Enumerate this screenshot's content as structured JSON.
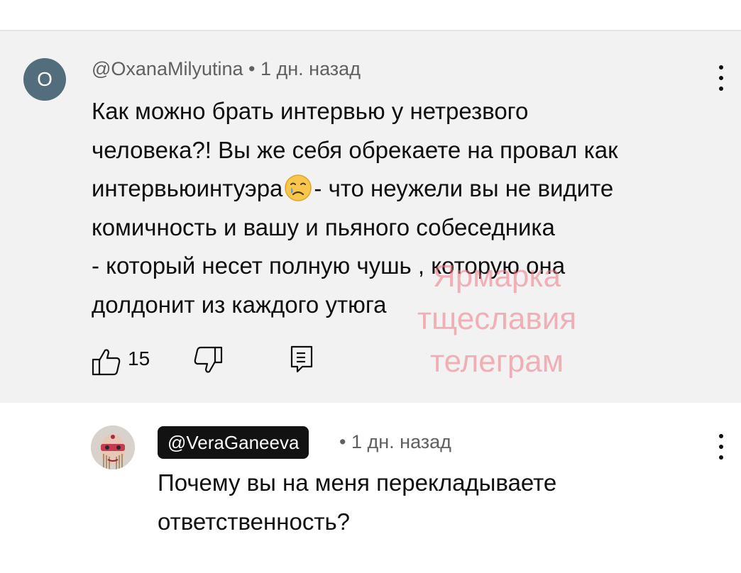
{
  "comments": [
    {
      "avatar_letter": "O",
      "avatar_color": "#526e7c",
      "author": "@OxanaMilyutina",
      "separator": "•",
      "time": "1 дн. назад",
      "text_lines": [
        "Как можно брать интервью у нетрезвого",
        "человека?! Вы же себя обрекаете на провал как",
        "интервьюинтуэра",
        "- что неужели вы не видите",
        "комичность и вашу и пьяного собеседника",
        "- который несет полную чушь , которую она",
        "долдонит из каждого утюга"
      ],
      "emoji": "crying-face-emoji",
      "likes": "15",
      "background": "#f2f2f2"
    },
    {
      "author": "@VeraGaneeva",
      "separator": "•",
      "time": "1 дн. назад",
      "text_lines": [
        "Почему вы на меня перекладываете",
        "ответственность?"
      ]
    }
  ],
  "watermark": {
    "lines": [
      "Ярмарка",
      "тщеславия",
      "телеграм"
    ],
    "color": "#ee7882"
  },
  "icons": {
    "like": "thumb-up-icon",
    "dislike": "thumb-down-icon",
    "reply": "comment-reply-icon",
    "menu": "more-vertical-icon"
  }
}
